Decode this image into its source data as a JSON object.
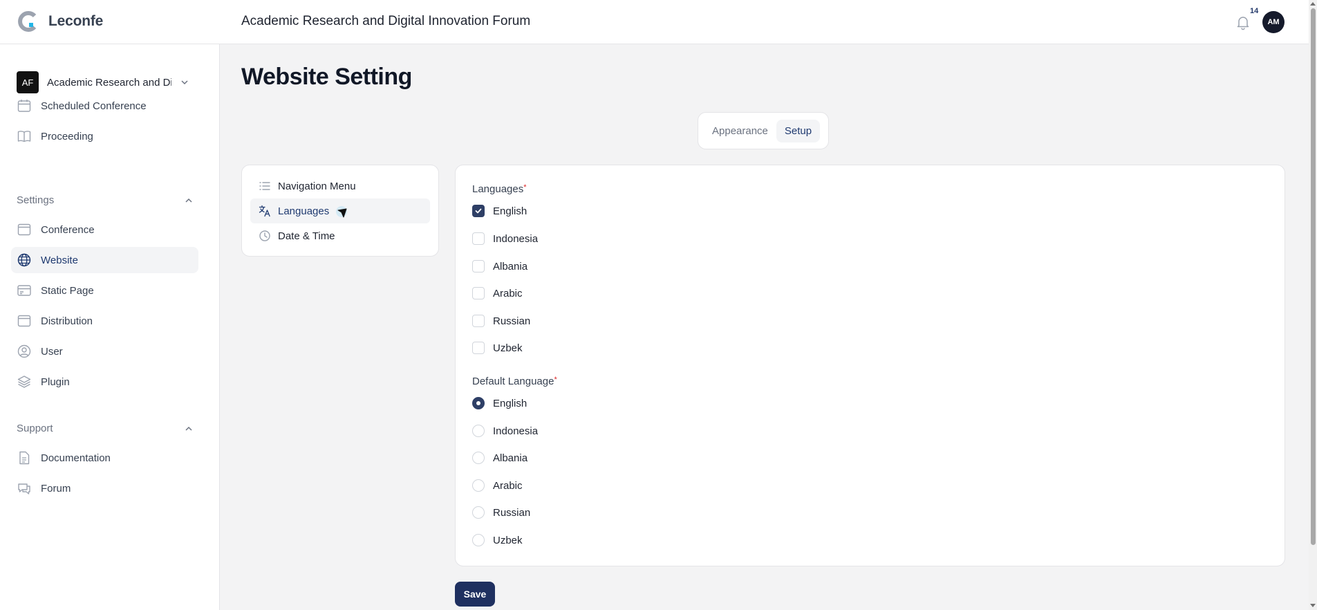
{
  "app": {
    "name": "Leconfe",
    "header_title": "Academic Research and Digital Innovation Forum"
  },
  "header": {
    "notification_count": "14",
    "user_initials": "AM"
  },
  "sidebar": {
    "conference": {
      "initials": "AF",
      "name": "Academic Research and Digital Innovation Forum"
    },
    "top_items": [
      {
        "label": "Scheduled Conference",
        "icon": "calendar-icon"
      },
      {
        "label": "Proceeding",
        "icon": "book-icon"
      }
    ],
    "settings": {
      "title": "Settings",
      "items": [
        {
          "label": "Conference",
          "icon": "window-icon"
        },
        {
          "label": "Website",
          "icon": "globe-icon",
          "active": true
        },
        {
          "label": "Static Page",
          "icon": "card-icon"
        },
        {
          "label": "Distribution",
          "icon": "window-icon"
        },
        {
          "label": "User",
          "icon": "user-circle-icon"
        },
        {
          "label": "Plugin",
          "icon": "layers-icon"
        }
      ]
    },
    "support": {
      "title": "Support",
      "items": [
        {
          "label": "Documentation",
          "icon": "document-icon"
        },
        {
          "label": "Forum",
          "icon": "chat-icon"
        }
      ]
    }
  },
  "main": {
    "title": "Website Setting",
    "tabs": [
      {
        "label": "Appearance",
        "active": false
      },
      {
        "label": "Setup",
        "active": true
      }
    ],
    "subnav": [
      {
        "label": "Navigation Menu",
        "icon": "list-icon"
      },
      {
        "label": "Languages",
        "icon": "translate-icon",
        "active": true
      },
      {
        "label": "Date & Time",
        "icon": "clock-icon"
      }
    ],
    "languages": {
      "label": "Languages",
      "required_mark": "*",
      "options": [
        {
          "label": "English",
          "checked": true
        },
        {
          "label": "Indonesia",
          "checked": false
        },
        {
          "label": "Albania",
          "checked": false
        },
        {
          "label": "Arabic",
          "checked": false
        },
        {
          "label": "Russian",
          "checked": false
        },
        {
          "label": "Uzbek",
          "checked": false
        }
      ]
    },
    "default_language": {
      "label": "Default Language",
      "required_mark": "*",
      "selected": "English",
      "options": [
        "English",
        "Indonesia",
        "Albania",
        "Arabic",
        "Russian",
        "Uzbek"
      ]
    },
    "save_label": "Save"
  },
  "colors": {
    "primary": "#1f3060",
    "active_text": "#1f3a70",
    "required": "#dc2626"
  }
}
